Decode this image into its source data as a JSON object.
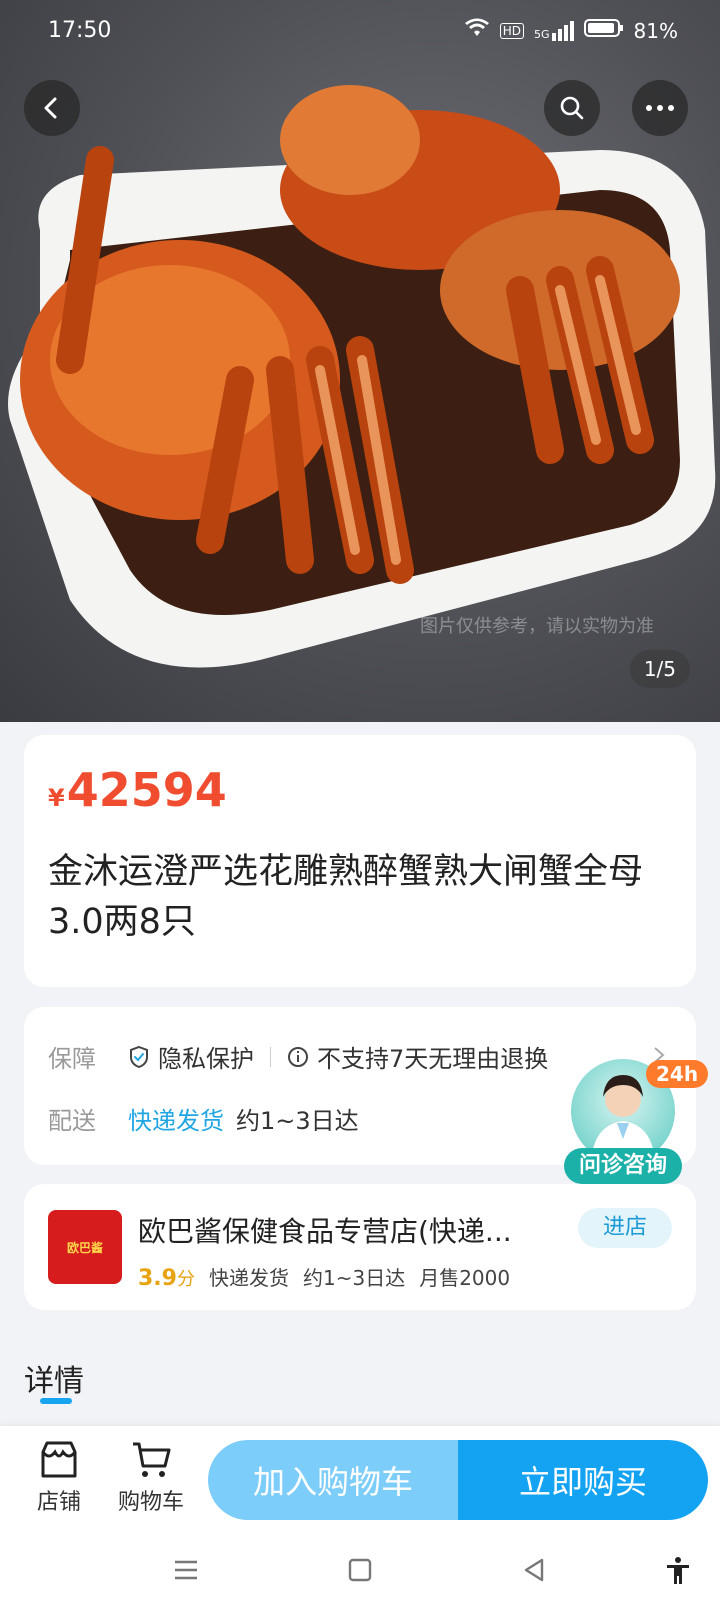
{
  "status": {
    "time": "17:50",
    "battery": "81%",
    "network": "5G",
    "hd": "HD"
  },
  "gallery": {
    "counter": "1/5",
    "watermark": "图片仅供参考，请以实物为准"
  },
  "product": {
    "currency": "¥",
    "price": "42594",
    "title": "金沐运澄严选花雕熟醉蟹熟大闸蟹全母3.0两8只"
  },
  "info": {
    "guarantee_label": "保障",
    "privacy": "隐私保护",
    "no_return": "不支持7天无理由退换",
    "delivery_label": "配送",
    "delivery_method": "快递发货",
    "delivery_eta": "约1~3日达"
  },
  "doctor": {
    "badge": "24h",
    "label": "问诊咨询"
  },
  "shop": {
    "logo_text": "欧巴酱",
    "name": "欧巴酱保健食品专营店(快递...",
    "score": "3.9",
    "score_unit": "分",
    "delivery": "快递发货",
    "eta": "约1~3日达",
    "monthly_sales": "月售2000",
    "enter_label": "进店"
  },
  "detail": {
    "tab_label": "详情"
  },
  "bottom": {
    "store_label": "店铺",
    "cart_label": "购物车",
    "add_to_cart": "加入购物车",
    "buy_now": "立即购买"
  },
  "colors": {
    "price": "#f04c2f",
    "accent": "#14a3f2",
    "add_cart": "#7dcdfb",
    "express": "#21a5e3"
  }
}
